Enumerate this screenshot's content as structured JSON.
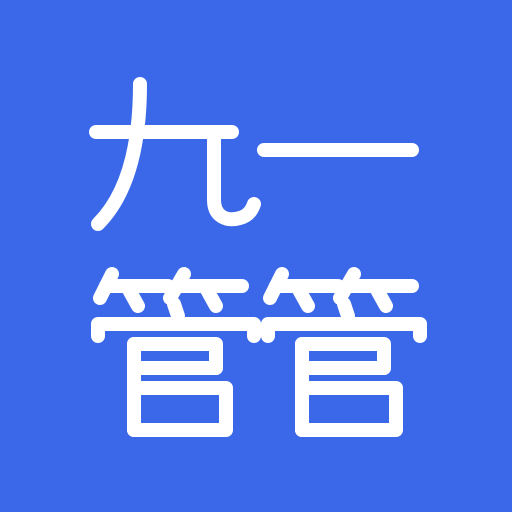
{
  "icon": {
    "line1": "九一",
    "line2": "管管",
    "background_color": "#3A68E8",
    "glyph_color": "#FFFFFF"
  }
}
